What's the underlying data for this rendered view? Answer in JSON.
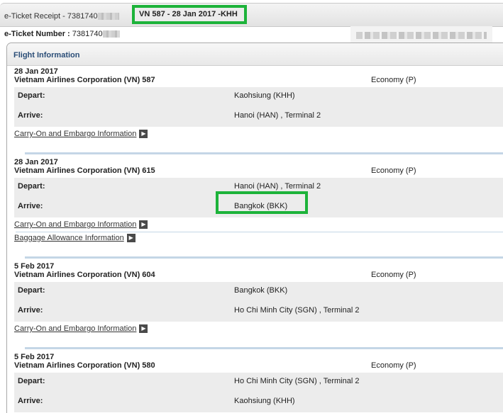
{
  "header": {
    "title_prefix": "e-Ticket Receipt - 7381740",
    "title_highlight": "VN 587 - 28 Jan 2017 -KHH"
  },
  "ticket": {
    "label": "e-Ticket Number :",
    "number_prefix": "7381740"
  },
  "section_title": "Flight Information",
  "labels": {
    "depart": "Depart:",
    "arrive": "Arrive:",
    "carry_on_link": "Carry-On and Embargo Information",
    "baggage_link": "Baggage Allowance Information"
  },
  "flights": [
    {
      "date": "28 Jan 2017",
      "airline": "Vietnam Airlines Corporation (VN)  587",
      "class": "Economy (P)",
      "depart": "Kaohsiung (KHH)",
      "arrive": "Hanoi (HAN) , Terminal 2"
    },
    {
      "date": "28 Jan 2017",
      "airline": "Vietnam Airlines Corporation (VN)  615",
      "class": "Economy (P)",
      "depart": "Hanoi (HAN) , Terminal 2",
      "arrive": "Bangkok (BKK)"
    },
    {
      "date": "5 Feb 2017",
      "airline": "Vietnam Airlines Corporation (VN)  604",
      "class": "Economy (P)",
      "depart": "Bangkok (BKK)",
      "arrive": "Ho Chi Minh City (SGN) , Terminal 2"
    },
    {
      "date": "5 Feb 2017",
      "airline": "Vietnam Airlines Corporation (VN)  580",
      "class": "Economy (P)",
      "depart": "Ho Chi Minh City (SGN) , Terminal 2",
      "arrive": "Kaohsiung (KHH)"
    }
  ],
  "colors": {
    "highlight": "#1db33a",
    "section_title": "#2a4d77",
    "row_bg": "#ececec"
  }
}
